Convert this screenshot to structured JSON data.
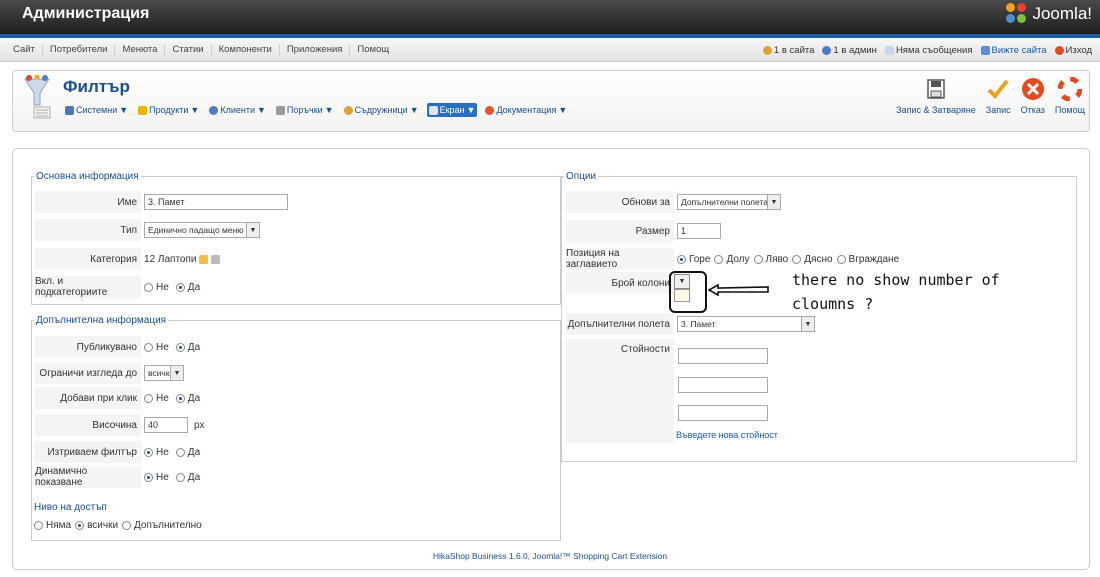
{
  "header": {
    "title": "Администрация",
    "logo_text": "Joomla!"
  },
  "menubar": {
    "items": [
      "Сайт",
      "Потребители",
      "Менюта",
      "Статии",
      "Компоненти",
      "Приложения",
      "Помощ"
    ],
    "status": {
      "users_on_site": "1 в сайта",
      "users_admin": "1 в админ",
      "messages": "Няма съобщения",
      "view_site": "Вижте сайта",
      "logout": "Изход"
    }
  },
  "toolbar": {
    "page_title": "Филтър",
    "submenu": [
      {
        "label": "Системни",
        "icon": "wrench-icon"
      },
      {
        "label": "Продукти",
        "icon": "folder-icon"
      },
      {
        "label": "Клиенти",
        "icon": "user-icon"
      },
      {
        "label": "Поръчки",
        "icon": "cart-icon"
      },
      {
        "label": "Съдружници",
        "icon": "partners-icon"
      },
      {
        "label": "Екран",
        "icon": "screen-icon",
        "active": true
      },
      {
        "label": "Документация",
        "icon": "help-icon"
      }
    ],
    "actions": {
      "save_close": "Запис & Затваряне",
      "save": "Запис",
      "cancel": "Отказ",
      "help": "Помощ"
    }
  },
  "basic": {
    "legend": "Основна информация",
    "name_label": "Име",
    "name_value": "3. Памет",
    "type_label": "Тип",
    "type_value": "Единично падащо меню",
    "category_label": "Категория",
    "category_value": "12 Лаптопи",
    "subcat_label": "Вкл. и подкатегориите",
    "no": "Не",
    "yes": "Да"
  },
  "additional": {
    "legend": "Допълнителна информация",
    "published_label": "Публикувано",
    "limit_view_label": "Ограничи изгледа до",
    "limit_view_value": "всички",
    "add_on_click_label": "Добави при клик",
    "height_label": "Височина",
    "height_value": "40",
    "height_unit": "px",
    "delete_filter_label": "Изтриваем филтър",
    "dynamic_label": "Динамично показване",
    "no": "Не",
    "yes": "Да",
    "access_title": "Ниво на достъп",
    "access_none": "Няма",
    "access_all": "всички",
    "access_additional": "Допълнително"
  },
  "options": {
    "legend": "Опции",
    "update_for_label": "Обнови за",
    "update_for_value": "Допълнителни полета",
    "size_label": "Размер",
    "size_value": "1",
    "title_pos_label": "Позиция на заглавието",
    "title_pos": [
      "Горе",
      "Долу",
      "Ляво",
      "Дясно",
      "Вграждане"
    ],
    "columns_label": "Брой колони",
    "extra_fields_label": "Допълнителни полета",
    "extra_fields_value": "3. Памет",
    "values_label": "Стойности",
    "new_value_link": "Въведете нова стойност"
  },
  "annotation": {
    "line1": "there no show number of",
    "line2": "cloumns ?"
  },
  "footer": {
    "text": "HikaShop Business 1.6.0, Joomla!™ Shopping Cart Extension"
  }
}
